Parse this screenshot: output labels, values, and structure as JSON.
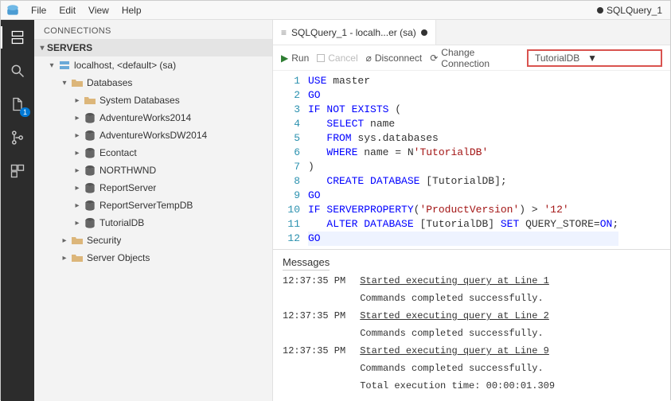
{
  "menubar": {
    "items": [
      "File",
      "Edit",
      "View",
      "Help"
    ],
    "status_right": "SQLQuery_1"
  },
  "sidebar": {
    "title": "CONNECTIONS",
    "section": "SERVERS",
    "server": {
      "label": "localhost, <default> (sa)",
      "databases_label": "Databases",
      "system_db_label": "System Databases",
      "items": [
        "AdventureWorks2014",
        "AdventureWorksDW2014",
        "Econtact",
        "NORTHWND",
        "ReportServer",
        "ReportServerTempDB",
        "TutorialDB"
      ],
      "security_label": "Security",
      "server_objects_label": "Server Objects"
    }
  },
  "editor": {
    "tab_label": "SQLQuery_1 - localh...er (sa)",
    "toolbar": {
      "run": "Run",
      "cancel": "Cancel",
      "disconnect": "Disconnect",
      "change_conn": "Change Connection",
      "db_selected": "TutorialDB"
    },
    "code_lines": [
      "USE master",
      "GO",
      "IF NOT EXISTS (",
      "   SELECT name",
      "   FROM sys.databases",
      "   WHERE name = N'TutorialDB'",
      ")",
      "   CREATE DATABASE [TutorialDB];",
      "GO",
      "IF SERVERPROPERTY('ProductVersion') > '12'",
      "   ALTER DATABASE [TutorialDB] SET QUERY_STORE=ON;",
      "GO"
    ]
  },
  "messages": {
    "title": "Messages",
    "rows": [
      {
        "time": "12:37:35 PM",
        "text": "Started executing query at Line 1",
        "link": true
      },
      {
        "time": "",
        "text": "Commands completed successfully.",
        "link": false
      },
      {
        "time": "12:37:35 PM",
        "text": "Started executing query at Line 2",
        "link": true
      },
      {
        "time": "",
        "text": "Commands completed successfully.",
        "link": false
      },
      {
        "time": "12:37:35 PM",
        "text": "Started executing query at Line 9",
        "link": true
      },
      {
        "time": "",
        "text": "Commands completed successfully.",
        "link": false
      },
      {
        "time": "",
        "text": "Total execution time: 00:00:01.309",
        "link": false
      }
    ]
  },
  "activity_badge": "1"
}
